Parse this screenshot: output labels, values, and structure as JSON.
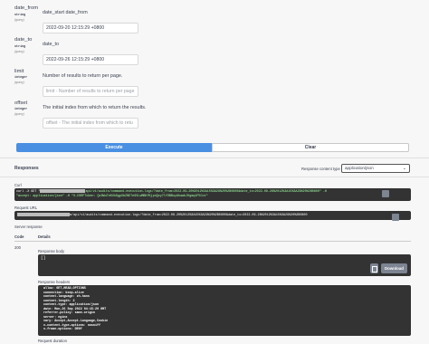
{
  "params": [
    {
      "name": "date_from",
      "type": "string",
      "location": "(query)",
      "description": "date_start date_from",
      "value": "2022-09-20 12:15:29 +0800",
      "placeholder": ""
    },
    {
      "name": "date_to",
      "type": "string",
      "location": "(query)",
      "description": "date_to",
      "value": "2022-09-26 12:15:29 +0800",
      "placeholder": ""
    },
    {
      "name": "limit",
      "type": "integer",
      "location": "(query)",
      "description": "Number of results to return per page.",
      "value": "",
      "placeholder": "limit - Number of results to return per page"
    },
    {
      "name": "offset",
      "type": "integer",
      "location": "(query)",
      "description": "The initial index from which to return the results.",
      "value": "",
      "placeholder": "offset - The initial index from which to retu"
    }
  ],
  "buttons": {
    "execute": "Execute",
    "clear": "Clear"
  },
  "responses": {
    "title": "Responses",
    "content_type_label": "Response content type",
    "content_type_value": "application/json",
    "curl_label": "Curl",
    "curl_line1_start": "curl -X GET \"",
    "curl_line1_end": "api/v1/audits/command-execution-logs/?date_from=2022-09-20%2012%3A15%3A29%20%2B0800&date_to=2022-09-26%2012%3A15%3A29%20%2B0800\" -H",
    "curl_line2": "\"accept: application/json\" -H  \"X-CSRFToken: Qv9WuTeKUhGgpXbZNE7e9VLwMBKfKjpnQoy7lfDBBuyAhawbJHgmqtF5Cot\"",
    "request_url_label": "Request URL",
    "request_url_tail": "m/api/v1/audits/command-execution-logs/?date_from=2022-09-20%2012%3A15%3A29%20%2B0800&date_to=2022-09-26%2012%3A15%3A29%20%2B0800",
    "server_response_label": "Server response",
    "code_header": "Code",
    "details_header": "Details",
    "status_code": "200",
    "response_body_label": "Response body",
    "response_body": "[]",
    "download_label": "Download",
    "response_headers_label": "Response headers",
    "headers": [
      "allow: GET,HEAD,OPTIONS",
      "connection: keep-alive",
      "content-language: zh-hans",
      "content-length: 2",
      "content-type: application/json",
      "date: Mon,26 Sep 2022 04:15:29 GMT",
      "referrer-policy: same-origin",
      "server: nginx",
      "vary: Accept,Accept-Language,Cookie",
      "x-content-type-options: nosniff",
      "x-frame-options: DENY"
    ],
    "request_duration_label": "Request duration"
  },
  "colors": {
    "execute": "#4990e2",
    "code_bg": "#333333"
  }
}
